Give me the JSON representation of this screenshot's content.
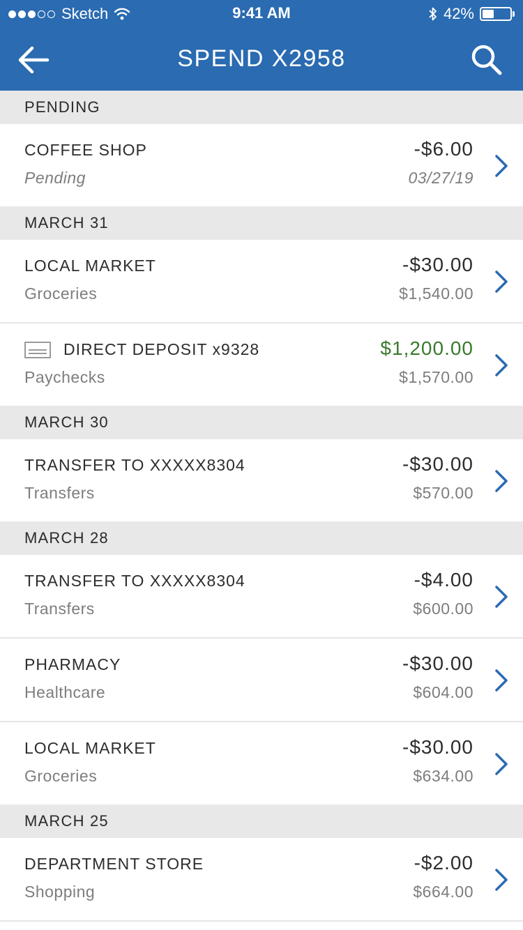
{
  "status_bar": {
    "carrier": "Sketch",
    "time": "9:41 AM",
    "battery_percent": "42%",
    "battery_level": 0.42
  },
  "nav": {
    "title": "SPEND X2958",
    "back_icon": "arrow-left-icon",
    "search_icon": "search-icon"
  },
  "colors": {
    "header_bg": "#2a6bb1",
    "section_bg": "#e8e8e8",
    "positive_amount": "#3b7a2e",
    "chevron": "#2a6bb1"
  },
  "sections": [
    {
      "header": "PENDING",
      "rows": [
        {
          "title": "COFFEE SHOP",
          "subtitle": "Pending",
          "amount": "-$6.00",
          "detail": "03/27/19"
        }
      ]
    },
    {
      "header": "MARCH 31",
      "rows": [
        {
          "title": "LOCAL MARKET",
          "subtitle": "Groceries",
          "amount": "-$30.00",
          "detail": "$1,540.00"
        },
        {
          "title": "DIRECT DEPOSIT x9328",
          "subtitle": "Paychecks",
          "amount": "$1,200.00",
          "detail": "$1,570.00"
        }
      ]
    },
    {
      "header": "MARCH 30",
      "rows": [
        {
          "title": "TRANSFER TO XXXXX8304",
          "subtitle": "Transfers",
          "amount": "-$30.00",
          "detail": "$570.00"
        }
      ]
    },
    {
      "header": "MARCH 28",
      "rows": [
        {
          "title": "TRANSFER TO XXXXX8304",
          "subtitle": "Transfers",
          "amount": "-$4.00",
          "detail": "$600.00"
        },
        {
          "title": "PHARMACY",
          "subtitle": "Healthcare",
          "amount": "-$30.00",
          "detail": "$604.00"
        },
        {
          "title": "LOCAL MARKET",
          "subtitle": "Groceries",
          "amount": "-$30.00",
          "detail": "$634.00"
        }
      ]
    },
    {
      "header": "MARCH 25",
      "rows": [
        {
          "title": "DEPARTMENT STORE",
          "subtitle": "Shopping",
          "amount": "-$2.00",
          "detail": "$664.00"
        }
      ]
    }
  ]
}
